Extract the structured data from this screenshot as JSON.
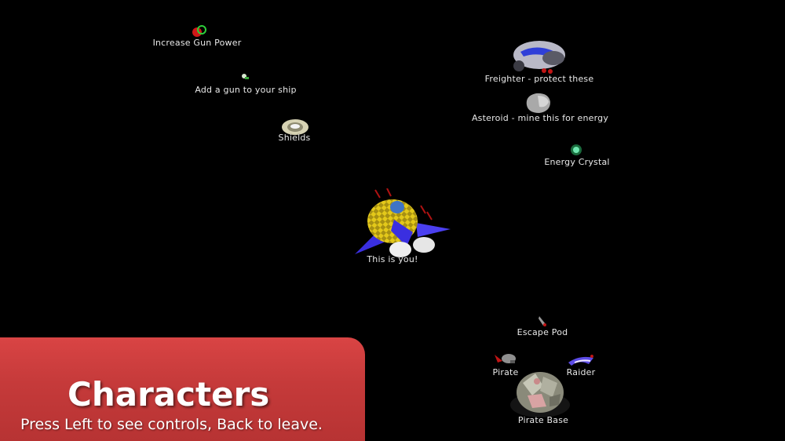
{
  "labels": {
    "gun_power": "Increase Gun Power",
    "add_gun": "Add a gun to your ship",
    "shields": "Shields",
    "player": "This is you!",
    "freighter": "Freighter - protect these",
    "asteroid": "Asteroid - mine this for energy",
    "energy_crystal": "Energy Crystal",
    "escape_pod": "Escape Pod",
    "pirate": "Pirate",
    "raider": "Raider",
    "pirate_base": "Pirate Base"
  },
  "panel": {
    "title": "Characters",
    "hint": "Press Left to see controls, Back to leave."
  },
  "colors": {
    "background": "#000000",
    "panel": "#c53a3a",
    "label_text": "#e8e8e8",
    "player_body": "#e8d21a",
    "player_wings": "#3a2fe0"
  }
}
